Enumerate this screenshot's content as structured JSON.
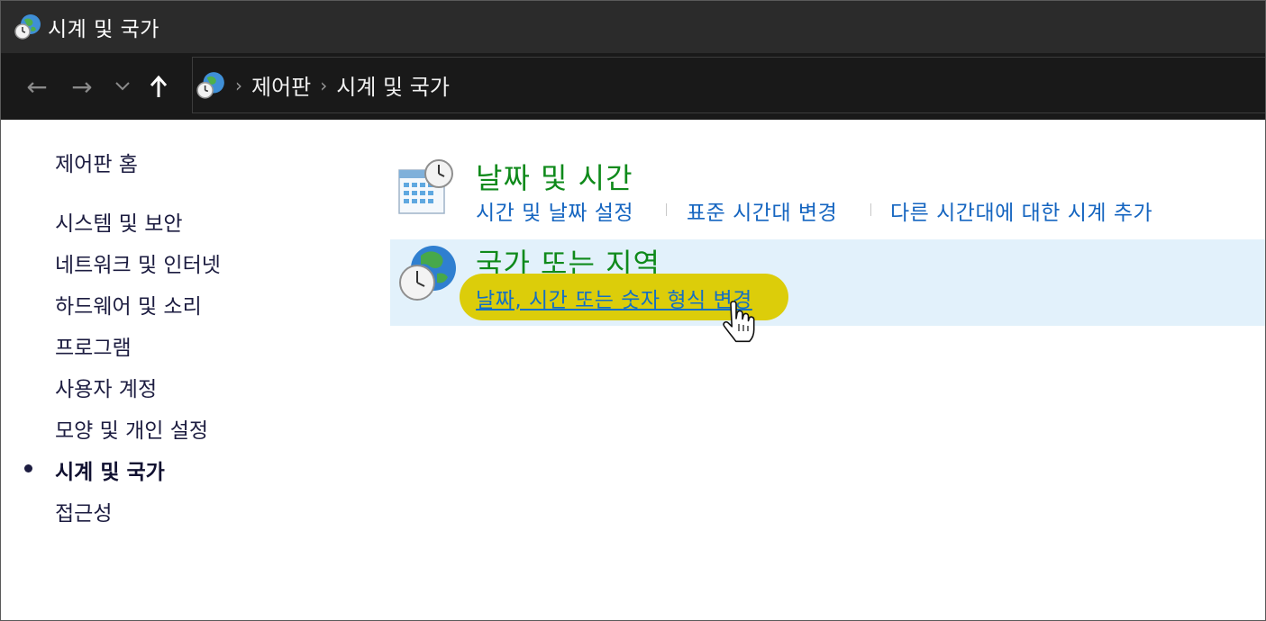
{
  "window": {
    "title": "시계 및 국가"
  },
  "nav": {
    "back_glyph": "←",
    "forward_glyph": "→",
    "recent_glyph": "⌄",
    "up_glyph": "↑",
    "breadcrumbs": [
      "제어판",
      "시계 및 국가"
    ],
    "separator": "›"
  },
  "sidebar": {
    "home": "제어판 홈",
    "items": [
      {
        "label": "시스템 및 보안"
      },
      {
        "label": "네트워크 및 인터넷"
      },
      {
        "label": "하드웨어 및 소리"
      },
      {
        "label": "프로그램"
      },
      {
        "label": "사용자 계정"
      },
      {
        "label": "모양 및 개인 설정"
      },
      {
        "label": "시계 및 국가",
        "active": true
      },
      {
        "label": "접근성"
      }
    ]
  },
  "main": {
    "categories": [
      {
        "title": "날짜 및 시간",
        "icon": "calendar-clock-icon",
        "links": [
          "시간 및 날짜 설정",
          "표준 시간대 변경",
          "다른 시간대에 대한 시계 추가"
        ]
      },
      {
        "title": "국가 또는 지역",
        "icon": "globe-clock-icon",
        "links": [
          "날짜, 시간 또는 숫자 형식 변경"
        ],
        "selected": true
      }
    ]
  },
  "colors": {
    "titlebar": "#2b2b2b",
    "navbar": "#191919",
    "category_title": "#0f8a1b",
    "link": "#1565c0",
    "highlight": "#dccd0a",
    "selected_row": "#e2f1fb"
  }
}
